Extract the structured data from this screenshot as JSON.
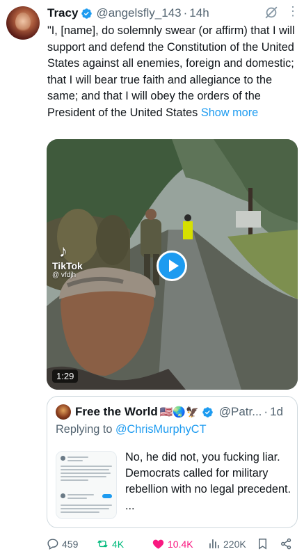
{
  "tweet": {
    "author_name": "Tracy",
    "handle": "@angelsfly_143",
    "separator": "·",
    "time": "14h",
    "more_label": "⋮",
    "text": "\"I, [name], do solemnly swear (or affirm) that I will support and defend the Constitution of the United States against all enemies, foreign and domestic; that I will bear true faith and allegiance to the same; and that I will obey the orders of the President of the United States",
    "show_more": "Show more"
  },
  "media": {
    "watermark": "TikTok",
    "watermark_user": "@ vfdjh",
    "duration": "1:29"
  },
  "quote": {
    "author_name": "Free the World",
    "emojis": "🇺🇸🌏🦅",
    "handle": "@Patr...",
    "separator": "·",
    "time": "1d",
    "replying_prefix": "Replying to",
    "replying_to": "@ChrisMurphyCT",
    "text": "No, he did not, you fucking liar. Democrats called for military rebellion with no legal precedent. ..."
  },
  "actions": {
    "replies": "459",
    "reposts": "4K",
    "likes": "10.4K",
    "views": "220K"
  },
  "colors": {
    "accent": "#1d9bf0",
    "repost": "#00ba7c",
    "like": "#f91880",
    "muted": "#536471"
  },
  "icons": [
    "verified-badge-icon",
    "grok-icon",
    "more-icon",
    "play-icon",
    "reply-icon",
    "repost-icon",
    "like-icon",
    "views-icon",
    "bookmark-icon",
    "share-icon"
  ]
}
